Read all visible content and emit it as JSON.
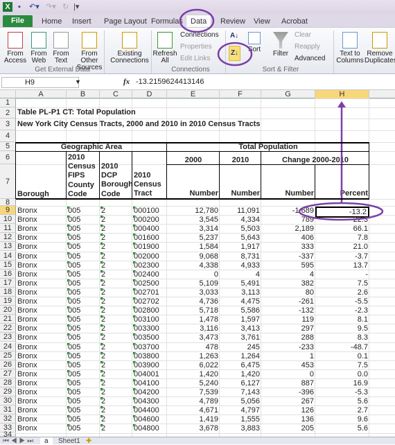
{
  "app": {
    "quick_access": [
      "excel-icon",
      "save-icon",
      "undo-icon",
      "redo-icon",
      "repeat-icon",
      "customize-icon"
    ]
  },
  "tabs": [
    "File",
    "Home",
    "Insert",
    "Page Layout",
    "Formulas",
    "Data",
    "Review",
    "View",
    "Acrobat"
  ],
  "active_tab": "Data",
  "ribbon": {
    "get_external": {
      "from_access": "From Access",
      "from_web": "From Web",
      "from_text": "From Text",
      "from_other": "From Other Sources",
      "existing": "Existing Connections",
      "label": "Get External Data"
    },
    "connections": {
      "refresh": "Refresh All",
      "connections": "Connections",
      "properties": "Properties",
      "edit_links": "Edit Links",
      "label": "Connections"
    },
    "sort_filter": {
      "sort": "Sort",
      "filter": "Filter",
      "clear": "Clear",
      "reapply": "Reapply",
      "advanced": "Advanced",
      "label": "Sort & Filter"
    },
    "tools": {
      "text_to_columns": "Text to Columns",
      "remove_duplicates": "Remove Duplicates"
    }
  },
  "formula_bar": {
    "name_box": "H9",
    "fx": "fx",
    "value": "-13.2159624413146"
  },
  "columns": [
    "A",
    "B",
    "C",
    "D",
    "E",
    "F",
    "G",
    "H"
  ],
  "selected_cell": "H9",
  "sheet": {
    "title1": "Table PL-P1 CT:  Total Population",
    "title2": "New York City Census Tracts, 2000 and 2010 in 2010 Census Tracts",
    "geo_area": "Geographic Area",
    "total_pop": "Total Population",
    "h2000": "2000",
    "h2010": "2010",
    "change": "Change 2000-2010",
    "borough": "Borough",
    "fips": "2010\nCensus\nFIPS\nCounty\nCode",
    "dcp": "2010\nDCP\nBorough\nCode",
    "tract": "2010\nCensus\nTract",
    "number": "Number",
    "percent": "Percent"
  },
  "rows": [
    [
      "9",
      "Bronx",
      "005",
      "2",
      "000100",
      "12,780",
      "11,091",
      "-1,689",
      "-13.2"
    ],
    [
      "10",
      "Bronx",
      "005",
      "2",
      "000200",
      "3,545",
      "4,334",
      "789",
      "22.3"
    ],
    [
      "11",
      "Bronx",
      "005",
      "2",
      "000400",
      "3,314",
      "5,503",
      "2,189",
      "66.1"
    ],
    [
      "12",
      "Bronx",
      "005",
      "2",
      "001600",
      "5,237",
      "5,643",
      "406",
      "7.8"
    ],
    [
      "13",
      "Bronx",
      "005",
      "2",
      "001900",
      "1,584",
      "1,917",
      "333",
      "21.0"
    ],
    [
      "14",
      "Bronx",
      "005",
      "2",
      "002000",
      "9,068",
      "8,731",
      "-337",
      "-3.7"
    ],
    [
      "15",
      "Bronx",
      "005",
      "2",
      "002300",
      "4,338",
      "4,933",
      "595",
      "13.7"
    ],
    [
      "16",
      "Bronx",
      "005",
      "2",
      "002400",
      "0",
      "4",
      "4",
      "-"
    ],
    [
      "17",
      "Bronx",
      "005",
      "2",
      "002500",
      "5,109",
      "5,491",
      "382",
      "7.5"
    ],
    [
      "18",
      "Bronx",
      "005",
      "2",
      "002701",
      "3,033",
      "3,113",
      "80",
      "2.6"
    ],
    [
      "19",
      "Bronx",
      "005",
      "2",
      "002702",
      "4,736",
      "4,475",
      "-261",
      "-5.5"
    ],
    [
      "20",
      "Bronx",
      "005",
      "2",
      "002800",
      "5,718",
      "5,586",
      "-132",
      "-2.3"
    ],
    [
      "21",
      "Bronx",
      "005",
      "2",
      "003100",
      "1,478",
      "1,597",
      "119",
      "8.1"
    ],
    [
      "22",
      "Bronx",
      "005",
      "2",
      "003300",
      "3,116",
      "3,413",
      "297",
      "9.5"
    ],
    [
      "23",
      "Bronx",
      "005",
      "2",
      "003500",
      "3,473",
      "3,761",
      "288",
      "8.3"
    ],
    [
      "24",
      "Bronx",
      "005",
      "2",
      "003700",
      "478",
      "245",
      "-233",
      "-48.7"
    ],
    [
      "25",
      "Bronx",
      "005",
      "2",
      "003800",
      "1,263",
      "1,264",
      "1",
      "0.1"
    ],
    [
      "26",
      "Bronx",
      "005",
      "2",
      "003900",
      "6,022",
      "6,475",
      "453",
      "7.5"
    ],
    [
      "27",
      "Bronx",
      "005",
      "2",
      "004001",
      "1,420",
      "1,420",
      "0",
      "0.0"
    ],
    [
      "28",
      "Bronx",
      "005",
      "2",
      "004100",
      "5,240",
      "6,127",
      "887",
      "16.9"
    ],
    [
      "29",
      "Bronx",
      "005",
      "2",
      "004200",
      "7,539",
      "7,143",
      "-396",
      "-5.3"
    ],
    [
      "30",
      "Bronx",
      "005",
      "2",
      "004300",
      "4,789",
      "5,056",
      "267",
      "5.6"
    ],
    [
      "31",
      "Bronx",
      "005",
      "2",
      "004400",
      "4,671",
      "4,797",
      "126",
      "2.7"
    ],
    [
      "32",
      "Bronx",
      "005",
      "2",
      "004600",
      "1,419",
      "1,555",
      "136",
      "9.6"
    ],
    [
      "33",
      "Bronx",
      "005",
      "2",
      "004800",
      "3,678",
      "3,883",
      "205",
      "5.6"
    ]
  ],
  "sheet_tabs": [
    "a",
    "Sheet1"
  ],
  "annotation_color": "#7b3fa8"
}
